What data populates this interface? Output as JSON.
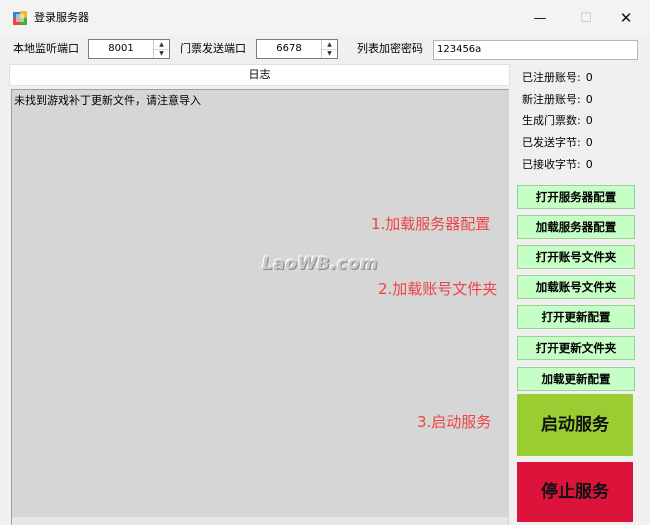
{
  "window": {
    "title": "登录服务器",
    "minimize": "—",
    "maximize": "☐",
    "close": "✕"
  },
  "fields": {
    "local_port_label": "本地监听端口",
    "local_port_value": "8001",
    "ticket_port_label": "门票发送端口",
    "ticket_port_value": "6678",
    "list_password_label": "列表加密密码",
    "list_password_value": "123456a"
  },
  "log": {
    "header": "日志",
    "lines": [
      "未找到游戏补丁更新文件，请注意导入"
    ]
  },
  "watermark": "LaoWB.com",
  "annotations": [
    "1.加载服务器配置",
    "2.加载账号文件夹",
    "3.启动服务"
  ],
  "stats": [
    {
      "label": "已注册账号:",
      "value": "0"
    },
    {
      "label": "新注册账号:",
      "value": "0"
    },
    {
      "label": "生成门票数:",
      "value": "0"
    },
    {
      "label": "已发送字节:",
      "value": "0"
    },
    {
      "label": "已接收字节:",
      "value": "0"
    }
  ],
  "buttons": {
    "open_server_config": "打开服务器配置",
    "load_server_config": "加载服务器配置",
    "open_account_folder": "打开账号文件夹",
    "load_account_folder": "加载账号文件夹",
    "open_update_config": "打开更新配置",
    "open_update_folder": "打开更新文件夹",
    "load_update_config": "加载更新配置",
    "start_service": "启动服务",
    "stop_service": "停止服务"
  },
  "colors": {
    "green_button": "#c6ffc6",
    "start_button": "#9acd32",
    "stop_button": "#dc143c",
    "annotation_text": "#ee4444"
  },
  "icons": {
    "app": "app-icon",
    "spin_up": "spin-up-arrow-icon",
    "spin_down": "spin-down-arrow-icon"
  }
}
